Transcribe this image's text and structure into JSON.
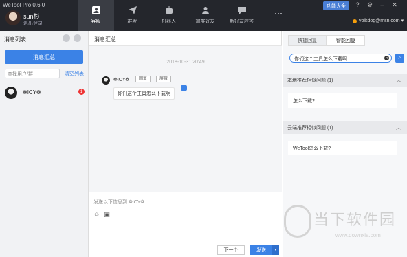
{
  "app": {
    "title": "WeTool Pro 0.6.0",
    "user_name": "sun杉",
    "logout_label": "退出登录",
    "feature_label": "功能大全",
    "account": "yolkdog@msn.com ▾"
  },
  "nav": [
    {
      "label": "客服",
      "icon": "user-icon"
    },
    {
      "label": "群发",
      "icon": "send-icon"
    },
    {
      "label": "机器人",
      "icon": "robot-icon"
    },
    {
      "label": "加群好友",
      "icon": "add-user-icon"
    },
    {
      "label": "新好友应答",
      "icon": "chat-icon"
    },
    {
      "label": "",
      "icon": "more-icon"
    }
  ],
  "left": {
    "title": "消息列表",
    "summary_label": "消息汇总",
    "search_placeholder": "查找用户/群",
    "clear_label": "清空列表",
    "contact_name": "❁ICY❁",
    "unread": "1"
  },
  "middle": {
    "title": "消息汇总",
    "timestamp": "2018-10-31 20:49",
    "sender": "❁ICY❁",
    "reply_tag": "回复",
    "block_tag": "屏蔽",
    "message": "你们这个工具怎么下载啊",
    "compose_hint": "发送以下信息到  ❁ICY❁",
    "next_label": "下一个",
    "send_label": "发送"
  },
  "right": {
    "tabs": [
      {
        "label": "快捷回复"
      },
      {
        "label": "智能回复"
      }
    ],
    "query": "你们这个工具怎么下载啊",
    "local_header": "本地推荐相似问题   (1)",
    "local_answer": "怎么下载?",
    "cloud_header": "云端推荐相似问题   (1)",
    "cloud_answer": "WeTool怎么下载?"
  },
  "watermark": {
    "text": "当下软件园",
    "url": "www.downxia.com"
  },
  "colors": {
    "accent": "#3b82e6",
    "titlebar": "#24262c"
  }
}
